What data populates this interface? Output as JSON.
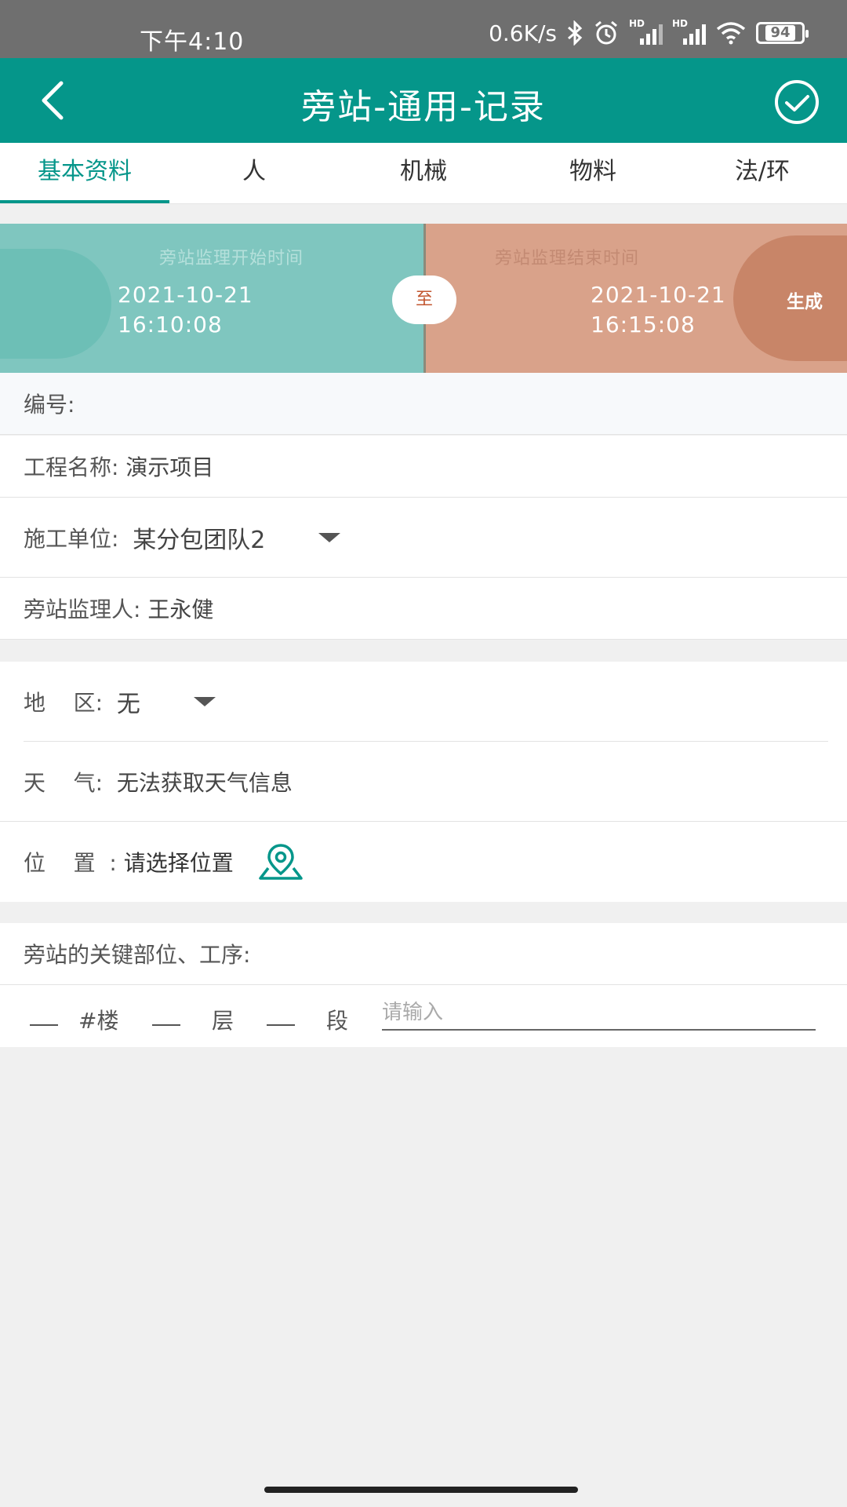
{
  "status_bar": {
    "time": "下午4:10",
    "net_speed": "0.6K/s",
    "hd_1": "HD",
    "hd_2": "HD",
    "battery": "94"
  },
  "app_bar": {
    "title": "旁站-通用-记录",
    "back_icon": "chevron-left-icon",
    "confirm_icon": "check-circle-icon"
  },
  "tabs": [
    {
      "label": "基本资料",
      "active": true
    },
    {
      "label": "人",
      "active": false
    },
    {
      "label": "机械",
      "active": false
    },
    {
      "label": "物料",
      "active": false
    },
    {
      "label": "法/环",
      "active": false
    }
  ],
  "time_banner": {
    "start_label": "旁站监理开始时间",
    "start_date": "2021-10-21",
    "start_time": "16:10:08",
    "to_label": "至",
    "end_label": "旁站监理结束时间",
    "end_date": "2021-10-21",
    "end_time": "16:15:08",
    "generate_label": "生成",
    "colors": {
      "start_bg": "#7fc6bf",
      "end_bg": "#d9a28a",
      "to_text": "#c2562f"
    }
  },
  "info": {
    "number_label": "编号:",
    "project_label": "工程名称: ",
    "project_value": "演示项目",
    "unit_label": "施工单位:  ",
    "unit_value": "某分包团队2",
    "supervisor_label": "旁站监理人: ",
    "supervisor_value": "王永健"
  },
  "env": {
    "region_label": "地    区:  ",
    "region_value": "无",
    "weather_label": "天    气:  ",
    "weather_value": "无法获取天气信息",
    "location_label": "位    置  : ",
    "location_value": "请选择位置",
    "location_icon": "map-pin-icon"
  },
  "key_parts": {
    "label": "旁站的关键部位、工序:",
    "building_suffix": "#楼",
    "floor_suffix": "层",
    "section_suffix": "段",
    "input_placeholder": "请输入"
  },
  "theme": {
    "accent": "#05968a",
    "status_bar": "#6f6f6f"
  }
}
